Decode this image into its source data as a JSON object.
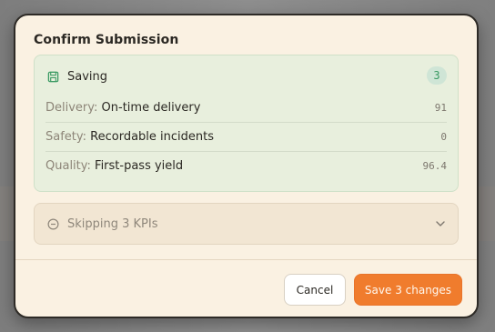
{
  "dialog": {
    "title": "Confirm Submission"
  },
  "saving": {
    "icon": "save-icon",
    "title": "Saving",
    "count": "3",
    "items": [
      {
        "category": "Delivery:",
        "name": "On-time delivery",
        "value": "91"
      },
      {
        "category": "Safety:",
        "name": "Recordable incidents",
        "value": "0"
      },
      {
        "category": "Quality:",
        "name": "First-pass yield",
        "value": "96.4"
      }
    ]
  },
  "skipping": {
    "icon": "minus-circle-icon",
    "label": "Skipping 3 KPIs",
    "expanded": false
  },
  "footer": {
    "cancel_label": "Cancel",
    "save_label": "Save 3 changes"
  },
  "colors": {
    "accent": "#f07c2d",
    "saving_bg": "#e8efdd",
    "badge_text": "#3a9a63"
  }
}
